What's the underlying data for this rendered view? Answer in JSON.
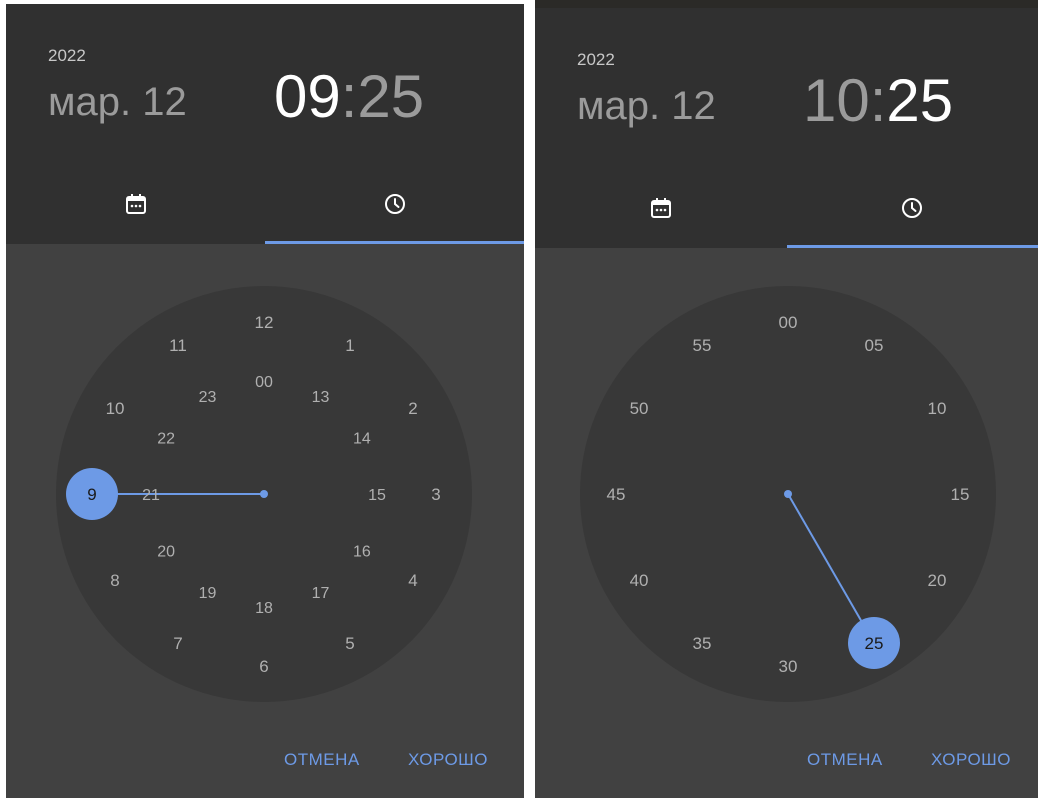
{
  "pickers": [
    {
      "year": "2022",
      "date": "мар. 12",
      "time": {
        "hours": "09",
        "separator": ":",
        "minutes": "25",
        "active": "hours"
      },
      "tabs": {
        "date_icon": "calendar-icon",
        "time_icon": "clock-icon",
        "active": "time"
      },
      "dial": {
        "mode": "hours",
        "outer_labels": [
          "12",
          "1",
          "2",
          "3",
          "4",
          "5",
          "6",
          "7",
          "8",
          "9",
          "10",
          "11"
        ],
        "inner_labels": [
          "00",
          "13",
          "14",
          "15",
          "16",
          "17",
          "18",
          "19",
          "20",
          "21",
          "22",
          "23"
        ],
        "selected_label": "9",
        "selected_value": 9
      },
      "actions": {
        "cancel": "ОТМЕНА",
        "ok": "ХОРОШО"
      }
    },
    {
      "year": "2022",
      "date": "мар. 12",
      "time": {
        "hours": "10",
        "separator": ":",
        "minutes": "25",
        "active": "minutes"
      },
      "tabs": {
        "date_icon": "calendar-icon",
        "time_icon": "clock-icon",
        "active": "time"
      },
      "dial": {
        "mode": "minutes",
        "outer_labels": [
          "00",
          "05",
          "10",
          "15",
          "20",
          "25",
          "30",
          "35",
          "40",
          "45",
          "50",
          "55"
        ],
        "inner_labels": [],
        "selected_label": "25",
        "selected_value": 25
      },
      "actions": {
        "cancel": "ОТМЕНА",
        "ok": "ХОРОШО"
      }
    }
  ],
  "colors": {
    "accent": "#6d9ae6",
    "header_bg": "#303030",
    "body_bg": "#414141",
    "dial_bg": "#383838",
    "label": "#b0b0b0",
    "active_text": "#ffffff",
    "inactive_text": "#9b9b9b"
  }
}
